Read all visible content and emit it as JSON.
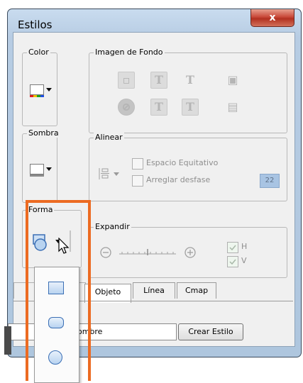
{
  "window": {
    "title": "Estilos",
    "close_glyph": "x"
  },
  "groups": {
    "color": "Color",
    "shadow": "Sombra",
    "shape": "Forma",
    "background_image": "Imagen de Fondo",
    "align": "Alinear",
    "expand": "Expandir"
  },
  "background_icons": [
    "image-placeholder-icon",
    "text-icon",
    "text-clear-icon",
    "image-fit-icon",
    "no-image-icon",
    "text-small-icon",
    "text-corner-icon",
    "image-stretch-icon"
  ],
  "align": {
    "equal_spacing_label": "Espacio Equitativo",
    "fix_offset_label": "Arreglar desfase",
    "offset_value": "22"
  },
  "expand": {
    "h_label": "H",
    "v_label": "V"
  },
  "tabs": [
    "Objeto",
    "Línea",
    "Cmap"
  ],
  "name_field": {
    "value": "nombre"
  },
  "create_style_button": "Crear Estilo",
  "shape_options": [
    "rectangle-shape",
    "rounded-rectangle-shape",
    "ellipse-shape"
  ],
  "colors": {
    "highlight": "#ec6b22",
    "accent": "#3b6fb5"
  }
}
